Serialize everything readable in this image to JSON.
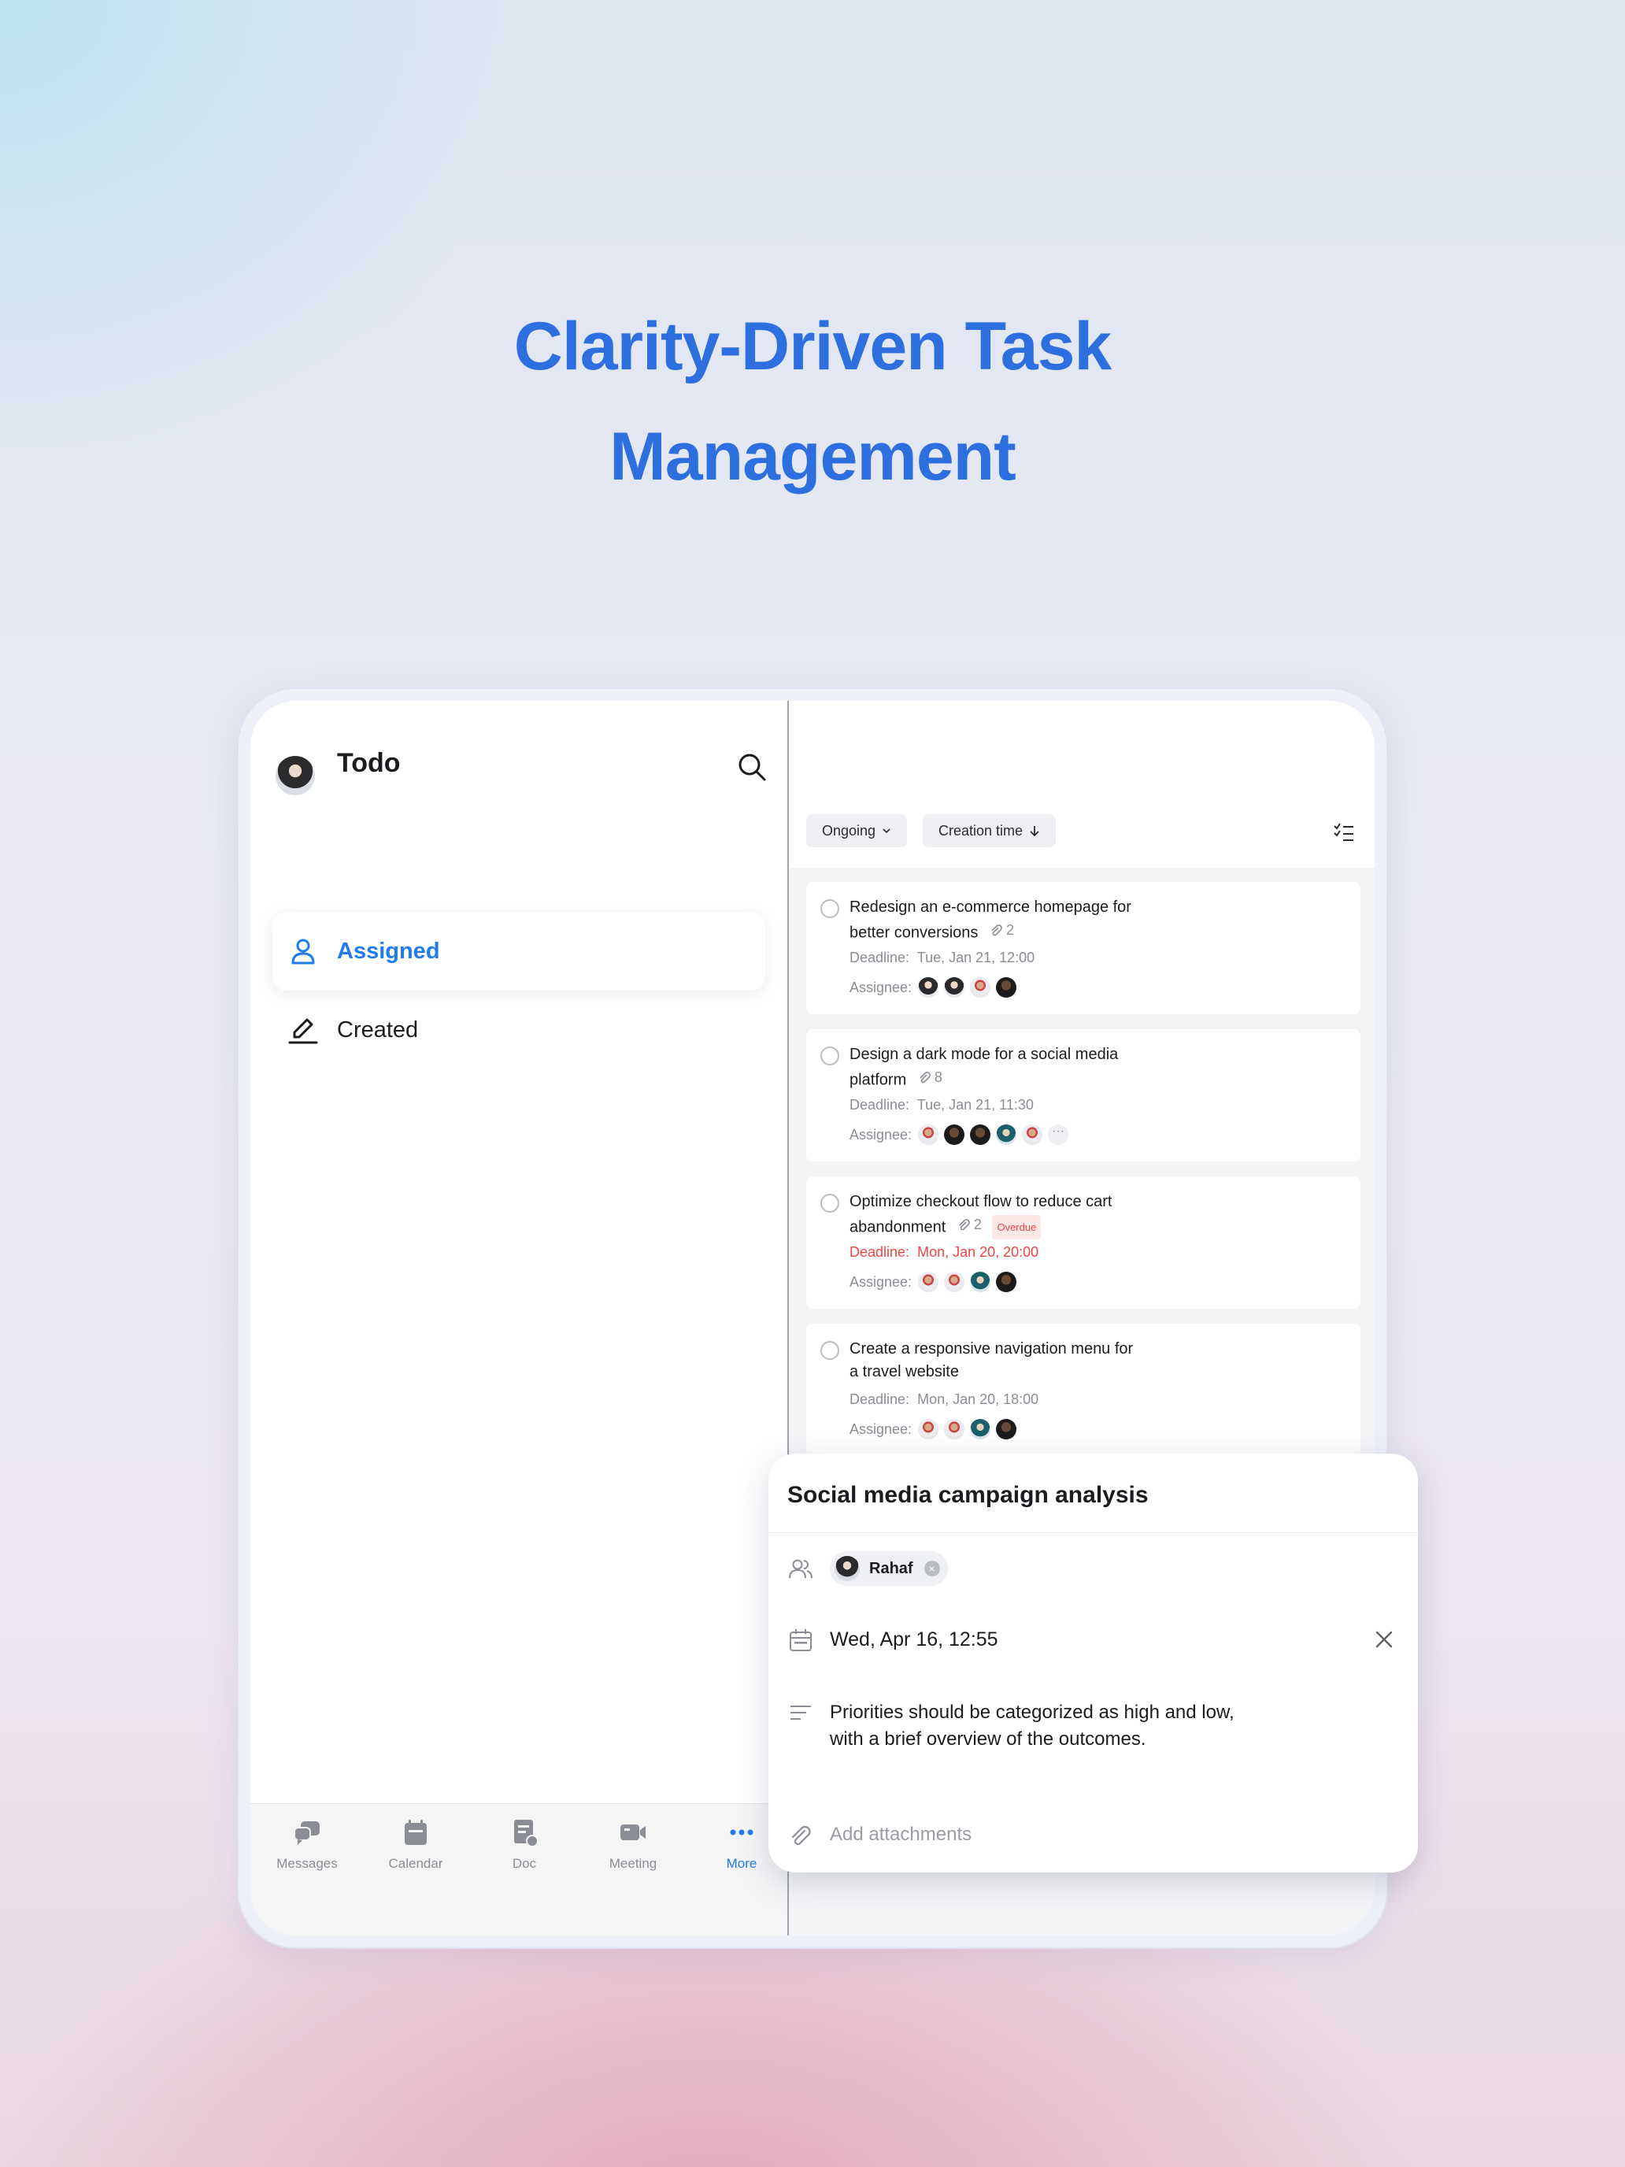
{
  "headline": {
    "line1": "Clarity-Driven Task",
    "line2": "Management"
  },
  "sidebar": {
    "title": "Todo",
    "items": [
      {
        "label": "Assigned",
        "active": true
      },
      {
        "label": "Created",
        "active": false
      }
    ]
  },
  "tabbar": {
    "tabs": [
      {
        "label": "Messages",
        "icon": "chat-bubbles-icon"
      },
      {
        "label": "Calendar",
        "icon": "calendar-icon"
      },
      {
        "label": "Doc",
        "icon": "doc-icon"
      },
      {
        "label": "Meeting",
        "icon": "video-camera-icon"
      },
      {
        "label": "More",
        "icon": "more-dots-icon",
        "active": true
      }
    ]
  },
  "filters": {
    "status": "Ongoing",
    "sort": "Creation time"
  },
  "tasks": [
    {
      "title_line1": "Redesign an e-commerce homepage for",
      "title_line2": "better conversions",
      "attachments": "2",
      "deadline_label": "Deadline:",
      "deadline": "Tue, Jan 21, 12:00",
      "assignee_label": "Assignee:"
    },
    {
      "title_line1": "Design a dark mode for a social media",
      "title_line2": "platform",
      "attachments": "8",
      "deadline_label": "Deadline:",
      "deadline": "Tue, Jan 21, 11:30",
      "assignee_label": "Assignee:",
      "more": "···"
    },
    {
      "title_line1": "Optimize checkout flow to reduce cart",
      "title_line2": "abandonment",
      "attachments": "2",
      "overdue": "Overdue",
      "deadline_label": "Deadline:",
      "deadline": "Mon, Jan 20, 20:00",
      "assignee_label": "Assignee:"
    },
    {
      "title_line1": "Create a responsive navigation menu for",
      "title_line2": "a travel website",
      "deadline_label": "Deadline:",
      "deadline": "Mon, Jan 20, 18:00",
      "assignee_label": "Assignee:"
    }
  ],
  "popover": {
    "title": "Social media campaign analysis",
    "assignee": "Rahaf",
    "remove_glyph": "×",
    "date": "Wed, Apr 16, 12:55",
    "description": "Priorities should be categorized as high and low, with a brief overview of the outcomes.",
    "attachments_placeholder": "Add attachments"
  },
  "colors": {
    "accent": "#1f7cf0",
    "headline": "#2e6fe0",
    "overdue": "#ef4444"
  }
}
